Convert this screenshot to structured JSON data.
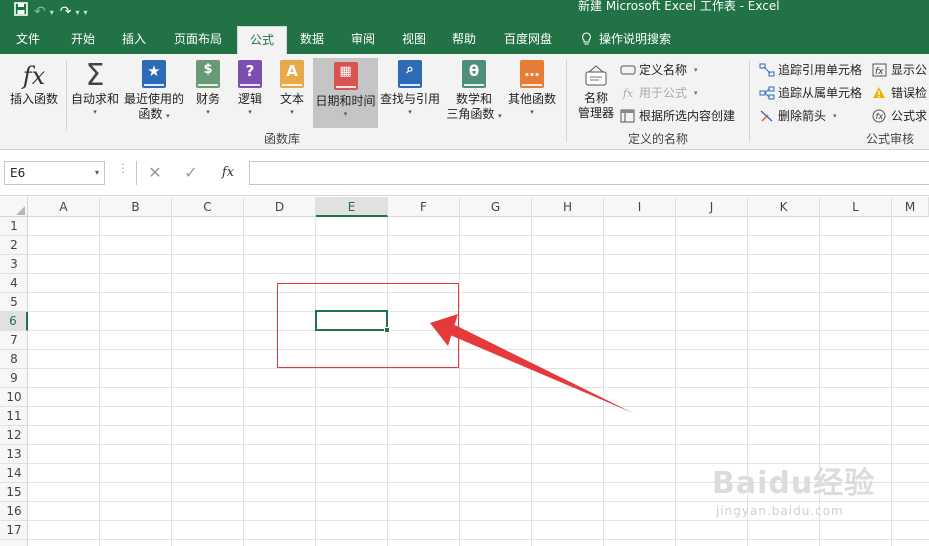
{
  "window": {
    "title": "新建 Microsoft Excel 工作表  -  Excel"
  },
  "quick_access": {
    "icons": [
      "save-icon",
      "undo-icon",
      "redo-icon",
      "customize-icon"
    ]
  },
  "tabs": [
    {
      "label": "文件"
    },
    {
      "label": "开始"
    },
    {
      "label": "插入"
    },
    {
      "label": "页面布局"
    },
    {
      "label": "公式",
      "active": true
    },
    {
      "label": "数据"
    },
    {
      "label": "审阅"
    },
    {
      "label": "视图"
    },
    {
      "label": "帮助"
    },
    {
      "label": "百度网盘"
    },
    {
      "label": "操作说明搜索"
    }
  ],
  "ribbon": {
    "function_library": {
      "group_label": "函数库",
      "insert_function": "插入函数",
      "autosum": "自动求和",
      "recent": [
        "最近使用的",
        "函数"
      ],
      "financial": "财务",
      "logical": "逻辑",
      "text": "文本",
      "datetime": "日期和时间",
      "lookup": "查找与引用",
      "math": [
        "数学和",
        "三角函数"
      ],
      "more": "其他函数"
    },
    "defined_names": {
      "group_label": "定义的名称",
      "name_manager": [
        "名称",
        "管理器"
      ],
      "define_name": "定义名称",
      "use_in_formula": "用于公式",
      "create_from_selection": "根据所选内容创建"
    },
    "formula_auditing": {
      "group_label": "公式审核",
      "trace_precedents": "追踪引用单元格",
      "trace_dependents": "追踪从属单元格",
      "remove_arrows": "删除箭头",
      "show_formulas": "显示公",
      "error_checking": "错误检",
      "evaluate_formula": "公式求"
    }
  },
  "formula_bar": {
    "name_box": "E6",
    "cancel_symbol": "✕",
    "enter_symbol": "✓",
    "fx_symbol": "fx",
    "formula": ""
  },
  "grid": {
    "columns": [
      "A",
      "B",
      "C",
      "D",
      "E",
      "F",
      "G",
      "H",
      "I",
      "J",
      "K",
      "L",
      "M"
    ],
    "rows": [
      "1",
      "2",
      "3",
      "4",
      "5",
      "6",
      "7",
      "8",
      "9",
      "10",
      "11",
      "12",
      "13",
      "14",
      "15",
      "16",
      "17"
    ],
    "active_column": "E",
    "active_row": "6",
    "active_cell": "E6"
  },
  "watermark": {
    "text": "Baidu经验",
    "url": "jingyan.baidu.com"
  },
  "colors": {
    "accent": "#217346",
    "annotation": "#e5393c"
  }
}
